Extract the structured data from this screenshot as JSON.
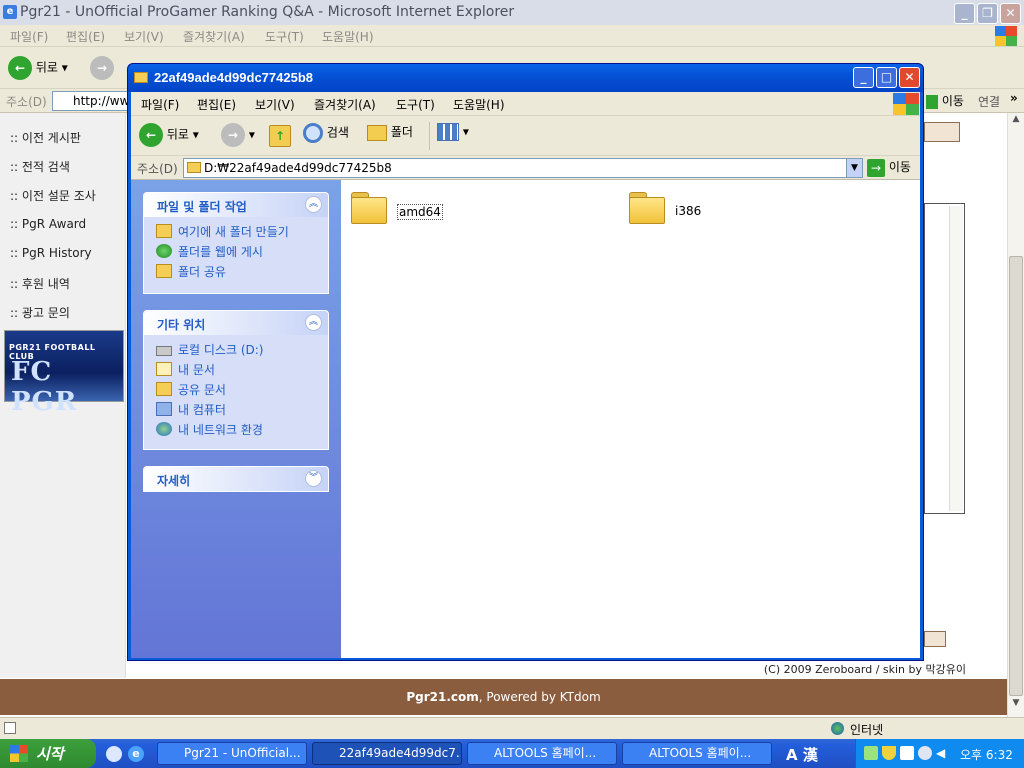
{
  "ie": {
    "title": "Pgr21 - UnOfficial ProGamer Ranking Q&A - Microsoft Internet Explorer",
    "menu": [
      "파일(F)",
      "편집(E)",
      "보기(V)",
      "즐겨찾기(A)",
      "도구(T)",
      "도움말(H)"
    ],
    "back_label": "뒤로",
    "address_label": "주소(D)",
    "address_value": "http://ww",
    "go_label": "이동",
    "links_label": "연결",
    "nav_items": [
      ":: 이전 게시판",
      ":: 전적 검색",
      ":: 이전 설문 조사",
      ":: PgR Award",
      ":: PgR History",
      ":: 후원 내역",
      ":: 광고 문의"
    ],
    "banner_small": "PGR21 FOOTBALL CLUB",
    "banner_big": "FC PGR",
    "copyright": "(C) 2009 Zeroboard / skin by 막강유이",
    "footer_site": "Pgr21.com",
    "footer_rest": ", Powered by KTdom",
    "status_zone": "인터넷"
  },
  "explorer": {
    "title": "22af49ade4d99dc77425b8",
    "menu": [
      "파일(F)",
      "편집(E)",
      "보기(V)",
      "즐겨찾기(A)",
      "도구(T)",
      "도움말(H)"
    ],
    "toolbar": {
      "back": "뒤로",
      "search": "검색",
      "folders": "폴더"
    },
    "address_label": "주소(D)",
    "address_value": "D:₩22af49ade4d99dc77425b8",
    "go_label": "이동",
    "tasks_panel": {
      "title": "파일 및 폴더 작업",
      "items": [
        "여기에 새 폴더 만들기",
        "폴더를 웹에 게시",
        "폴더 공유"
      ]
    },
    "places_panel": {
      "title": "기타 위치",
      "items": [
        "로컬 디스크 (D:)",
        "내 문서",
        "공유 문서",
        "내 컴퓨터",
        "내 네트워크 환경"
      ]
    },
    "details_panel": {
      "title": "자세히"
    },
    "files": [
      {
        "name": "amd64"
      },
      {
        "name": "i386"
      }
    ]
  },
  "taskbar": {
    "start_label": "시작",
    "tasks": [
      "Pgr21 - UnOfficial...",
      "22af49ade4d99dc7...",
      "ALTOOLS 홈페이...",
      "ALTOOLS 홈페이..."
    ],
    "ime": "A 漢",
    "clock": "오후 6:32"
  },
  "colors": {
    "xp_blue": "#0a5bd8",
    "task_pane": "#6375d6",
    "footer_brown": "#8b5d3f",
    "start_green": "#2f8a2f"
  }
}
